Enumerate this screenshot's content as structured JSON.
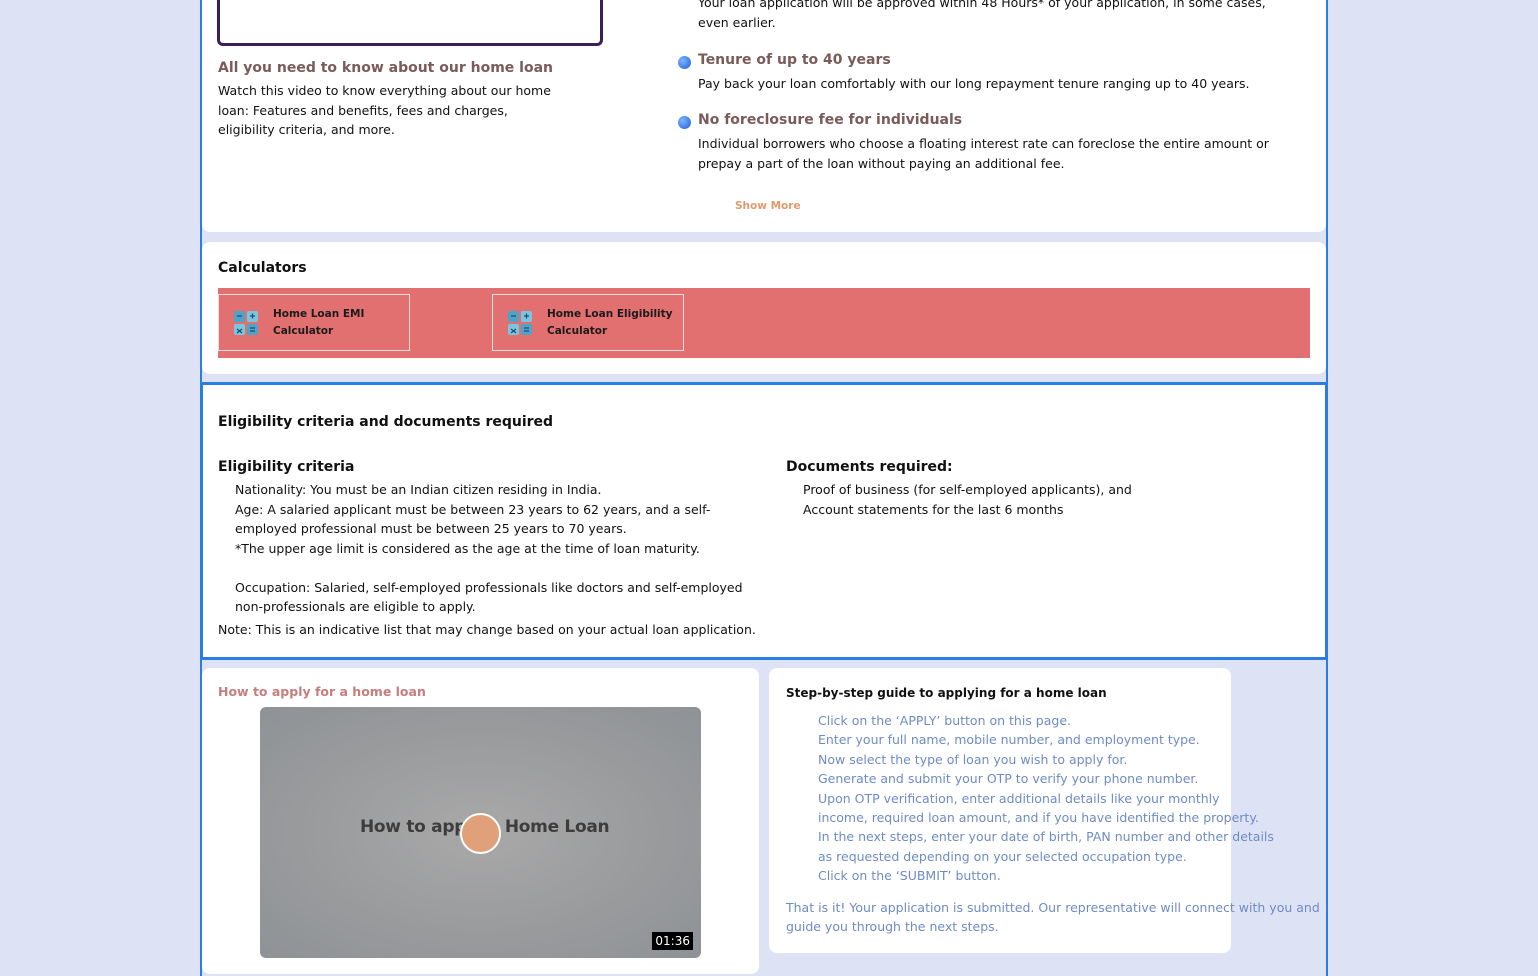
{
  "intro": {
    "video_title": "All you need to know about our home loan",
    "video_desc": "Watch this video to know everything about our home loan: Features and benefits, fees and charges, eligibility criteria, and more.",
    "approval_text": "Your loan application will be approved within 48 Hours* of your application, in some cases, even earlier.",
    "features": [
      {
        "title": "Tenure of up to 40 years",
        "desc": "Pay back your loan comfortably with our long repayment tenure ranging up to 40 years."
      },
      {
        "title": "No foreclosure fee for individuals",
        "desc": "Individual borrowers who choose a floating interest rate can foreclose the entire amount or prepay a part of the loan without paying an additional fee."
      }
    ],
    "show_more": "Show More"
  },
  "calculators": {
    "title": "Calculators",
    "items": [
      {
        "line1": "Home Loan EMI",
        "line2": "Calculator"
      },
      {
        "line1": "Home Loan Eligibility",
        "line2": "Calculator"
      }
    ]
  },
  "eligibility": {
    "title": "Eligibility criteria and documents required",
    "criteria_heading": "Eligibility criteria",
    "criteria": [
      "Nationality: You must be an Indian citizen residing in India.",
      "Age: A salaried applicant must be between 23 years to 62 years, and a self-employed professional must be between 25 years to 70 years.",
      "*The upper age limit is considered as the age at the time of loan maturity.",
      "Occupation: Salaried, self-employed professionals like doctors and self-employed non-professionals are eligible to apply."
    ],
    "docs_heading": "Documents required:",
    "docs": [
      "Proof of business (for self-employed applicants), and",
      "Account statements for the last 6 months"
    ],
    "note": "Note: This is an indicative list that may change based on your actual loan application."
  },
  "apply": {
    "title": "How to apply for a home loan",
    "video_text": "How to apply    Home Loan",
    "duration": "01:36"
  },
  "guide": {
    "title": "Step-by-step guide to applying for a home loan",
    "steps": [
      "Click on the ‘APPLY’ button on this page.",
      "Enter your full name, mobile number, and employment type.",
      "Now select the type of loan you wish to apply for.",
      "Generate and submit your OTP to verify your phone number.",
      "Upon OTP verification, enter additional details like your monthly income, required loan amount, and if you have identified the property.",
      "In the next steps, enter your date of birth, PAN number and other details as requested depending on your selected occupation type.",
      "Click on the ‘SUBMIT’ button."
    ],
    "ending": "That is it! Your application is submitted. Our representative will connect with you and guide you through the next steps."
  }
}
